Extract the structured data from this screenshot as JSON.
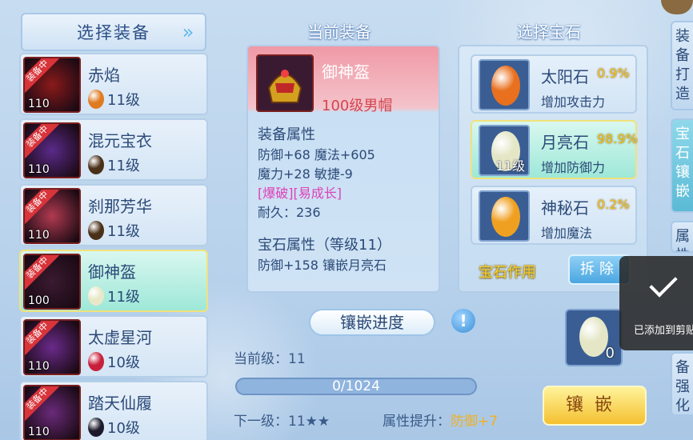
{
  "left_panel": {
    "title": "选择装备",
    "items": [
      {
        "name": "赤焰",
        "level": "110",
        "tag": "装备中",
        "gem_level": "11级",
        "gem_color": "#e07a20"
      },
      {
        "name": "混元宝衣",
        "level": "110",
        "tag": "装备中",
        "gem_level": "11级",
        "gem_color": "#4a3018"
      },
      {
        "name": "刹那芳华",
        "level": "110",
        "tag": "装备中",
        "gem_level": "11级",
        "gem_color": "#4a3018"
      },
      {
        "name": "御神盔",
        "level": "100",
        "tag": "装备中",
        "gem_level": "11级",
        "gem_color": "#e8e8c8"
      },
      {
        "name": "太虚星河",
        "level": "110",
        "tag": "装备中",
        "gem_level": "10级",
        "gem_color": "#c8203a"
      },
      {
        "name": "踏天仙履",
        "level": "110",
        "tag": "装备中",
        "gem_level": "10级",
        "gem_color": "#1a1a2a"
      }
    ]
  },
  "current_equip": {
    "title": "当前装备",
    "name": "御神盔",
    "subtitle": "100级男帽",
    "attr_header": "装备属性",
    "attr_line1": "防御+68 魔法+605",
    "attr_line2": "魔力+28 敏捷-9",
    "special": "[爆破][易成长]",
    "durability": "耐久：236",
    "gem_attr_header": "宝石属性（等级11）",
    "gem_attr_line": "防御+158 镶嵌月亮石"
  },
  "gem_panel": {
    "title": "选择宝石",
    "gems": [
      {
        "name": "太阳石",
        "rate": "0.9%",
        "desc": "增加攻击力",
        "color": "#e8701e",
        "level": ""
      },
      {
        "name": "月亮石",
        "rate": "98.9%",
        "desc": "增加防御力",
        "color": "#e4e6c6",
        "level": "11级"
      },
      {
        "name": "神秘石",
        "rate": "0.2%",
        "desc": "增加魔法",
        "color": "#f0a020",
        "level": ""
      }
    ],
    "effect_label": "宝石作用",
    "remove_label": "拆除"
  },
  "progress": {
    "title": "镶嵌进度",
    "help": "!",
    "current_level": "当前级：11",
    "bar_text": "0/1024",
    "fill_fraction": 0.0,
    "next_level": "下一级：11★★",
    "attr_up_label": "属性提升：",
    "attr_up_value": "防御+7"
  },
  "slot": {
    "count": "0",
    "gem_color": "#e4e6c6"
  },
  "inlay_label": "镶嵌",
  "side_tabs": [
    "装备打造",
    "宝石镶嵌",
    "属性",
    "备强化"
  ],
  "toast": {
    "message": "已添加到剪贴板"
  }
}
